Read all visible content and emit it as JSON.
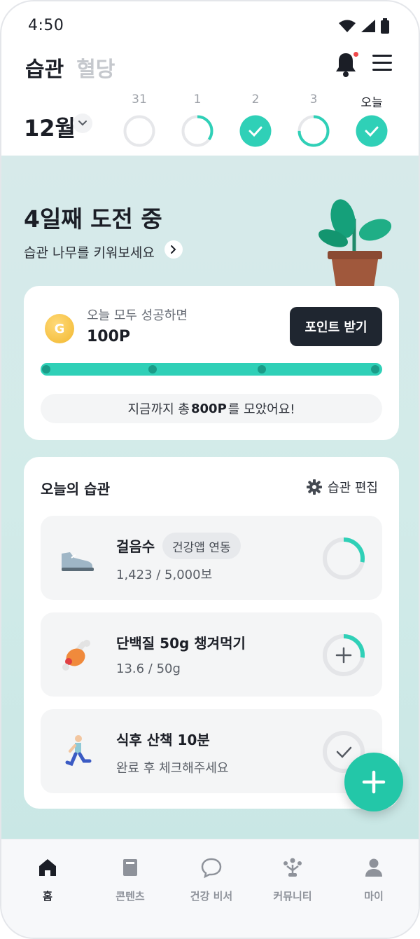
{
  "status_bar": {
    "time": "4:50"
  },
  "header": {
    "tabs": [
      {
        "label": "습관",
        "active": true
      },
      {
        "label": "혈당",
        "active": false
      }
    ],
    "month": "12월",
    "days": [
      {
        "label": "31",
        "status": "empty",
        "progress": 0
      },
      {
        "label": "1",
        "status": "partial",
        "progress": 0.35
      },
      {
        "label": "2",
        "status": "done",
        "progress": 1
      },
      {
        "label": "3",
        "status": "partial",
        "progress": 0.75
      },
      {
        "label": "오늘",
        "status": "done",
        "progress": 1,
        "today": true
      }
    ]
  },
  "challenge": {
    "title": "4일째 도전 중",
    "subtitle": "습관 나무를 키워보세요"
  },
  "points_card": {
    "coin_letter": "G",
    "label": "오늘 모두 성공하면",
    "value": "100P",
    "button": "포인트 받기",
    "progress": 1,
    "total_prefix": "지금까지 총 ",
    "total_value": "800P",
    "total_suffix": "를 모았어요!"
  },
  "habits": {
    "title": "오늘의 습관",
    "edit_label": "습관 편집",
    "items": [
      {
        "name": "걸음수",
        "badge": "건강앱 연동",
        "detail": "1,423 / 5,000보",
        "icon": "sneaker-icon",
        "action": "none",
        "progress": 0.28
      },
      {
        "name": "단백질 50g 챙겨먹기",
        "detail": "13.6 / 50g",
        "icon": "meat-icon",
        "action": "add",
        "progress": 0.27
      },
      {
        "name": "식후 산책 10분",
        "detail": "완료 후 체크해주세요",
        "icon": "walking-person-icon",
        "action": "check",
        "progress": 0
      }
    ]
  },
  "bottom_nav": [
    {
      "label": "홈",
      "icon": "home-icon",
      "active": true
    },
    {
      "label": "콘텐츠",
      "icon": "book-icon",
      "active": false
    },
    {
      "label": "건강 비서",
      "icon": "chat-bubble-icon",
      "active": false
    },
    {
      "label": "커뮤니티",
      "icon": "community-icon",
      "active": false
    },
    {
      "label": "마이",
      "icon": "person-icon",
      "active": false
    }
  ],
  "colors": {
    "accent": "#2fd0b7",
    "dark": "#1f2630",
    "background": "#d2ebe9"
  }
}
